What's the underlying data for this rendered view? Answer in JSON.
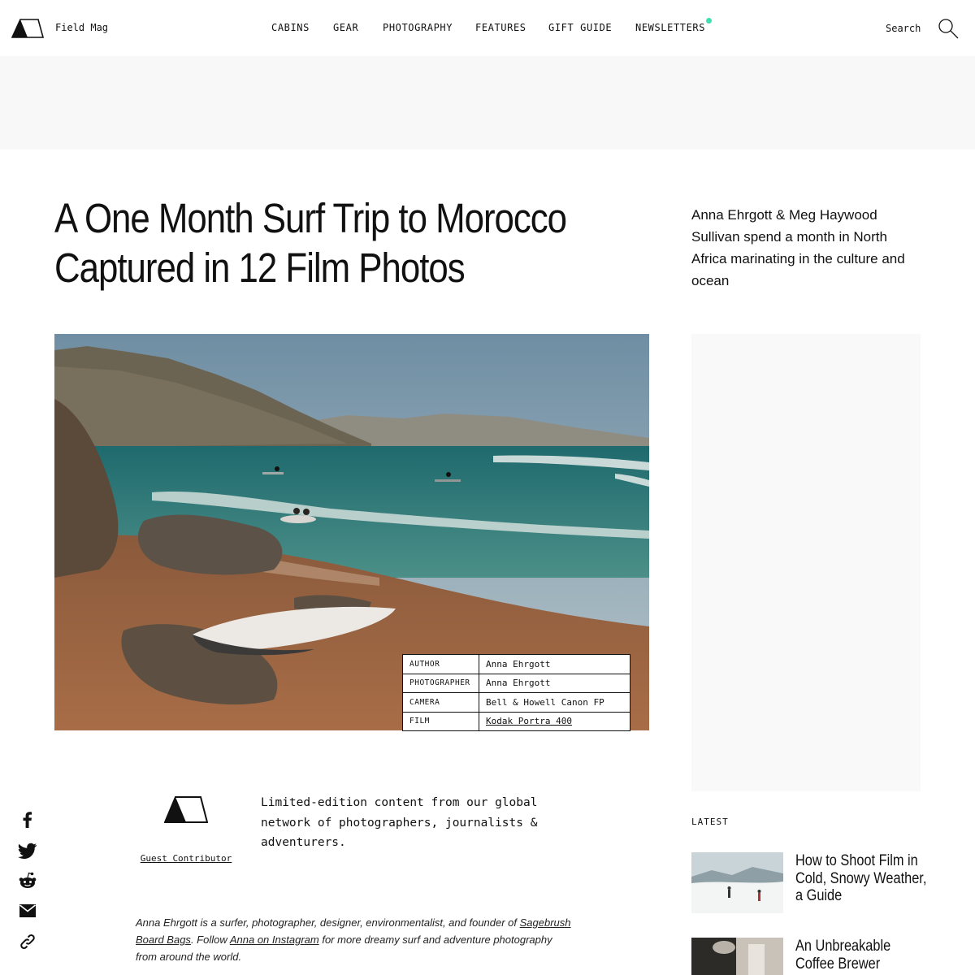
{
  "header": {
    "brand": "Field Mag",
    "nav": [
      {
        "label": "CABINS"
      },
      {
        "label": "GEAR"
      },
      {
        "label": "PHOTOGRAPHY"
      },
      {
        "label": "FEATURES"
      },
      {
        "label": "GIFT GUIDE"
      },
      {
        "label": "NEWSLETTERS"
      }
    ],
    "search_label": "Search",
    "notification_color": "#3ee0b0"
  },
  "article": {
    "title_line1": "A One Month Surf Trip to Morocco",
    "title_line2": "Captured in 12 Film Photos",
    "dek": "Anna Ehrgott & Meg Haywood Sullivan spend a month in North Africa marinating in the culture and ocean",
    "credits": [
      {
        "key": "AUTHOR",
        "value": "Anna Ehrgott"
      },
      {
        "key": "PHOTOGRAPHER",
        "value": "Anna Ehrgott"
      },
      {
        "key": "CAMERA",
        "value": "Bell & Howell Canon FP"
      },
      {
        "key": "FILM",
        "value": "Kodak Portra 400"
      }
    ]
  },
  "contributor": {
    "link_label": "Guest Contributor",
    "description": "Limited-edition content from our global network of photographers, journalists & adventurers."
  },
  "bio": {
    "part1": "Anna Ehrgott is a surfer, photographer, designer, environmentalist, and founder of ",
    "link1": "Sagebrush Board Bags",
    "part2": ". Follow ",
    "link2": "Anna on Instagram",
    "part3": " for more dreamy surf and adventure photography from around the world."
  },
  "latest": {
    "label": "LATEST",
    "items": [
      {
        "title": "How to Shoot Film in Cold, Snowy Weather, a Guide"
      },
      {
        "title": "An Unbreakable Coffee Brewer"
      }
    ]
  },
  "share": {
    "icons": [
      "facebook-icon",
      "twitter-icon",
      "reddit-icon",
      "email-icon",
      "link-icon"
    ]
  }
}
